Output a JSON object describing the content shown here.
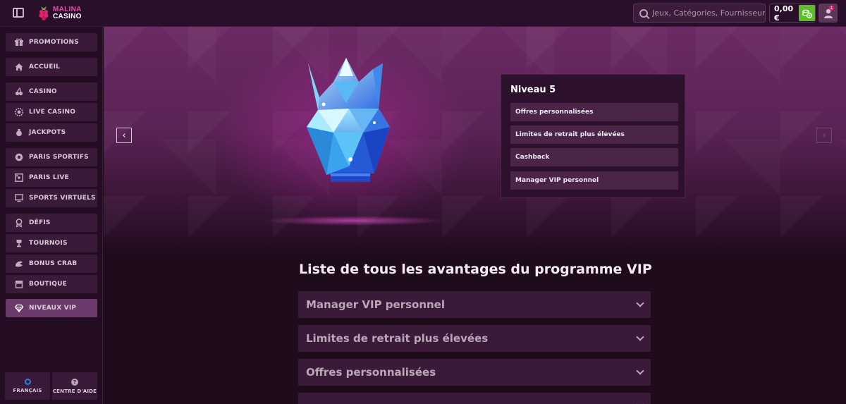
{
  "header": {
    "logo_line1": "MALINA",
    "logo_line2": "CASINO",
    "search_placeholder": "Jeux, Catégories, Fournisseurs",
    "balance": "0,00 €",
    "notification_count": "1"
  },
  "sidebar": {
    "items": [
      {
        "label": "PROMOTIONS",
        "icon": "gift-icon"
      },
      {
        "label": "ACCUEIL",
        "icon": "home-icon"
      },
      {
        "label": "CASINO",
        "icon": "cherries-icon"
      },
      {
        "label": "LIVE CASINO",
        "icon": "chip-icon"
      },
      {
        "label": "JACKPOTS",
        "icon": "bag-icon"
      },
      {
        "label": "PARIS SPORTIFS",
        "icon": "ball-icon"
      },
      {
        "label": "PARIS LIVE",
        "icon": "scoreboard-icon"
      },
      {
        "label": "SPORTS VIRTUELS",
        "icon": "monitor-icon"
      },
      {
        "label": "DÉFIS",
        "icon": "medal-icon"
      },
      {
        "label": "TOURNOIS",
        "icon": "trophy-icon"
      },
      {
        "label": "BONUS CRAB",
        "icon": "crab-icon"
      },
      {
        "label": "BOUTIQUE",
        "icon": "shop-icon"
      },
      {
        "label": "NIVEAUX VIP",
        "icon": "diamond-icon"
      }
    ],
    "language_label": "FRANÇAIS",
    "help_label": "CENTRE D'AIDE"
  },
  "hero": {
    "level_title": "Niveau 5",
    "benefits": [
      "Offres personnalisées",
      "Limites de retrait plus élevées",
      "Cashback",
      "Manager VIP personnel"
    ]
  },
  "vip_list": {
    "title": "Liste de tous les avantages du programme VIP",
    "items": [
      "Manager VIP personnel",
      "Limites de retrait plus élevées",
      "Offres personnalisées"
    ]
  },
  "colors": {
    "accent_pink": "#e84aa6",
    "deposit_green": "#5cbf2a",
    "sidebar_item": "#3a1a39",
    "active_item": "#6b3a6a"
  }
}
